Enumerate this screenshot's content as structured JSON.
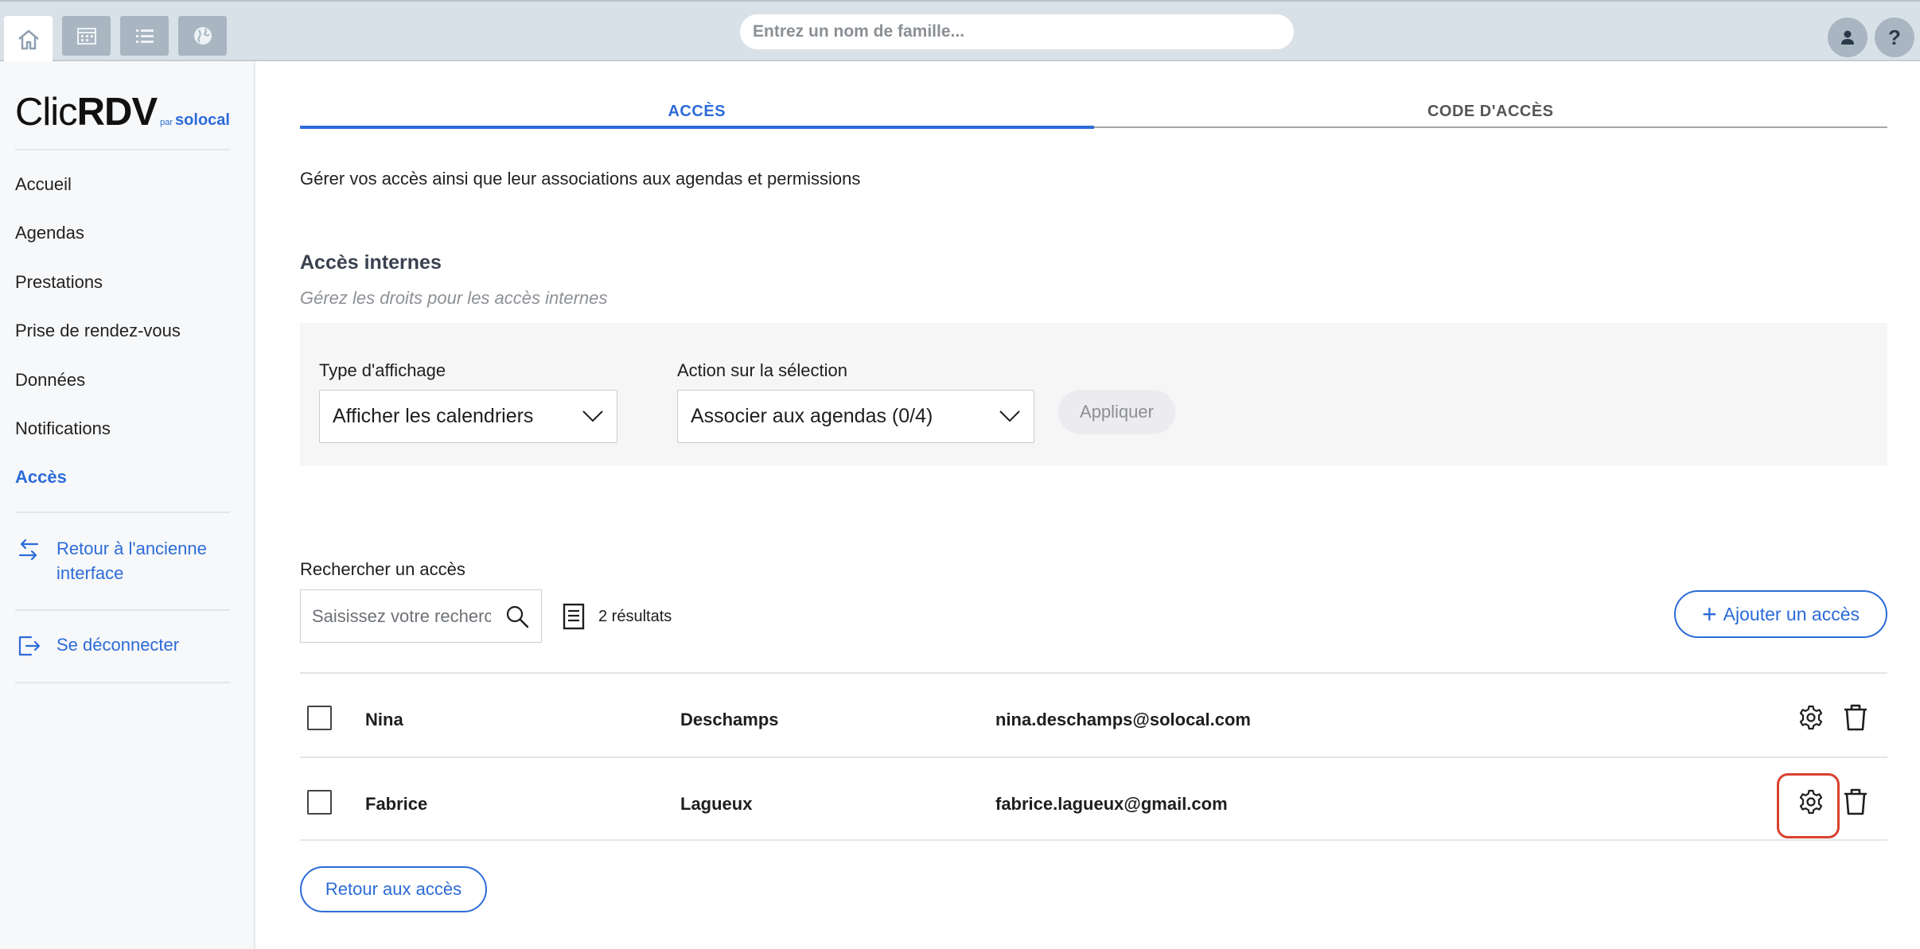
{
  "topbar": {
    "icons": [
      "home-icon",
      "calendar-icon",
      "list-icon",
      "globe-icon"
    ],
    "search_placeholder": "Entrez un nom de famille...",
    "help_label": "?"
  },
  "sidebar": {
    "logo": {
      "clic": "Clic",
      "rdv": "RDV",
      "par": "par",
      "solocal": "solocal"
    },
    "items": [
      {
        "label": "Accueil"
      },
      {
        "label": "Agendas"
      },
      {
        "label": "Prestations"
      },
      {
        "label": "Prise de rendez-vous"
      },
      {
        "label": "Données"
      },
      {
        "label": "Notifications"
      },
      {
        "label": "Accès",
        "active": true
      }
    ],
    "retour_ancienne": "Retour à l'ancienne interface",
    "deconnecter": "Se déconnecter"
  },
  "tabs": [
    {
      "label": "ACCÈS",
      "active": true
    },
    {
      "label": "CODE D'ACCÈS",
      "active": false
    }
  ],
  "description": "Gérer vos accès ainsi que leur associations aux agendas et permissions",
  "section": {
    "title": "Accès internes",
    "subtitle": "Gérez les droits pour les accès internes"
  },
  "filters": {
    "type_label": "Type d'affichage",
    "type_value": "Afficher les calendriers",
    "action_label": "Action sur la sélection",
    "action_value": "Associer aux agendas (0/4)",
    "apply_label": "Appliquer"
  },
  "search": {
    "label": "Rechercher un accès",
    "placeholder": "Saisissez votre recherche",
    "results": "2 résultats"
  },
  "add_button": "Ajouter un accès",
  "rows": [
    {
      "first": "Nina",
      "last": "Deschamps",
      "email": "nina.deschamps@solocal.com"
    },
    {
      "first": "Fabrice",
      "last": "Lagueux",
      "email": "fabrice.lagueux@gmail.com"
    }
  ],
  "back_button": "Retour aux accès",
  "colors": {
    "accent": "#2c6bd8",
    "highlight": "#d9412d",
    "topbar": "#d9e1e8"
  }
}
